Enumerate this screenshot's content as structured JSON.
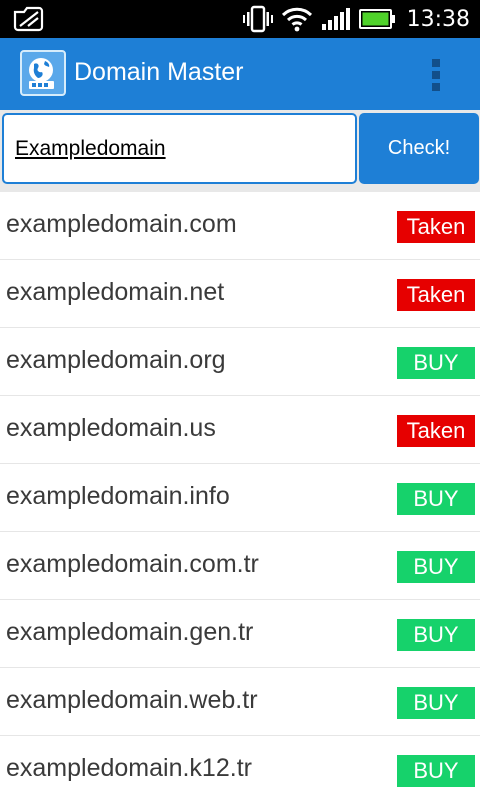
{
  "status_bar": {
    "time": "13:38"
  },
  "app_bar": {
    "title": "Domain Master"
  },
  "search": {
    "value": "Exampledomain",
    "button_label": "Check!"
  },
  "colors": {
    "accent": "#1e7fd6",
    "taken": "#e60000",
    "buy": "#16d26b"
  },
  "domains": [
    {
      "name": "exampledomain.com",
      "status": "Taken"
    },
    {
      "name": "exampledomain.net",
      "status": "Taken"
    },
    {
      "name": "exampledomain.org",
      "status": "BUY"
    },
    {
      "name": "exampledomain.us",
      "status": "Taken"
    },
    {
      "name": "exampledomain.info",
      "status": "BUY"
    },
    {
      "name": "exampledomain.com.tr",
      "status": "BUY"
    },
    {
      "name": "exampledomain.gen.tr",
      "status": "BUY"
    },
    {
      "name": "exampledomain.web.tr",
      "status": "BUY"
    },
    {
      "name": "exampledomain.k12.tr",
      "status": "BUY"
    }
  ]
}
